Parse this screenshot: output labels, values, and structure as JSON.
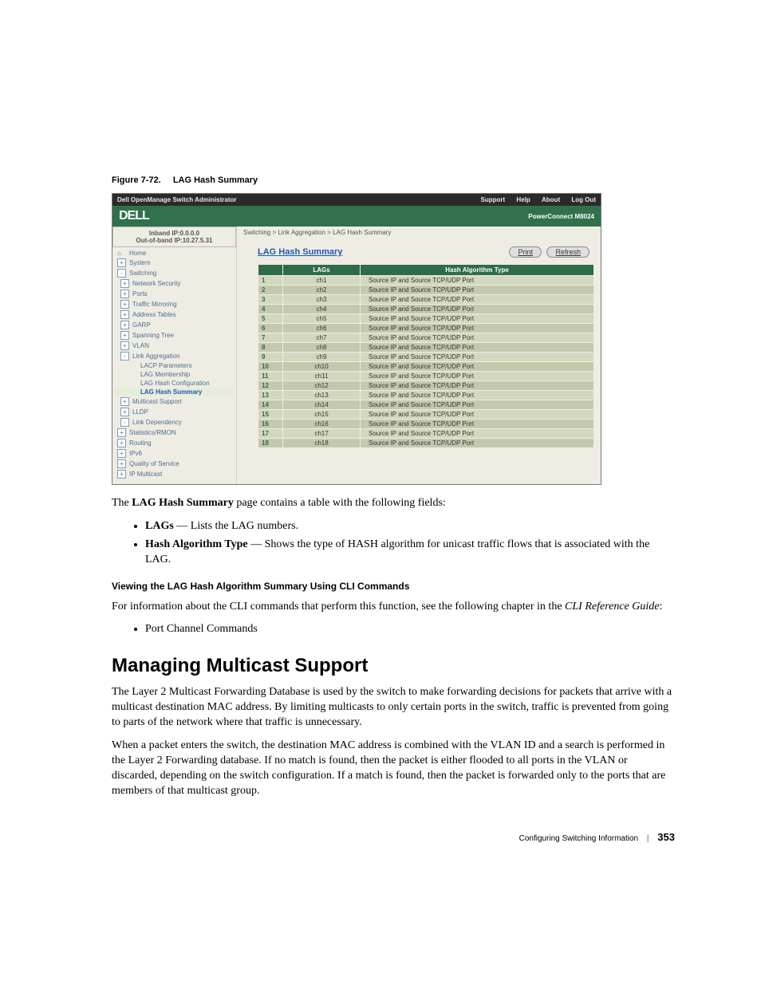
{
  "figure": {
    "num": "Figure 7-72.",
    "title": "LAG Hash Summary"
  },
  "shot": {
    "titlebar": {
      "appname": "Dell OpenManage Switch Administrator",
      "links": {
        "support": "Support",
        "help": "Help",
        "about": "About",
        "logout": "Log Out"
      }
    },
    "brand": {
      "logo": "DELL",
      "model": "PowerConnect M8024"
    },
    "ip": {
      "inband": "Inband IP:0.0.0.0",
      "outband": "Out-of-band IP:10.27.5.31"
    },
    "nav": [
      {
        "lvl": 0,
        "icon": "home",
        "label": "Home"
      },
      {
        "lvl": 0,
        "icon": "+",
        "label": "System"
      },
      {
        "lvl": 0,
        "icon": "-",
        "label": "Switching"
      },
      {
        "lvl": 1,
        "icon": "+",
        "label": "Network Security"
      },
      {
        "lvl": 1,
        "icon": "+",
        "label": "Ports"
      },
      {
        "lvl": 1,
        "icon": "+",
        "label": "Traffic Mirroring"
      },
      {
        "lvl": 1,
        "icon": "+",
        "label": "Address Tables"
      },
      {
        "lvl": 1,
        "icon": "+",
        "label": "GARP"
      },
      {
        "lvl": 1,
        "icon": "+",
        "label": "Spanning Tree"
      },
      {
        "lvl": 1,
        "icon": "+",
        "label": "VLAN"
      },
      {
        "lvl": 1,
        "icon": "-",
        "label": "Link Aggregation"
      },
      {
        "lvl": 2,
        "icon": "",
        "label": "LACP Parameters"
      },
      {
        "lvl": 2,
        "icon": "",
        "label": "LAG Membership"
      },
      {
        "lvl": 2,
        "icon": "",
        "label": "LAG Hash Configuration"
      },
      {
        "lvl": 2,
        "icon": "",
        "label": "LAG Hash Summary",
        "active": true
      },
      {
        "lvl": 1,
        "icon": "+",
        "label": "Multicast Support"
      },
      {
        "lvl": 1,
        "icon": "+",
        "label": "LLDP"
      },
      {
        "lvl": 1,
        "icon": "-",
        "label": "Link Dependency"
      },
      {
        "lvl": 0,
        "icon": "+",
        "label": "Statistics/RMON"
      },
      {
        "lvl": 0,
        "icon": "+",
        "label": "Routing"
      },
      {
        "lvl": 0,
        "icon": "+",
        "label": "IPv6"
      },
      {
        "lvl": 0,
        "icon": "+",
        "label": "Quality of Service"
      },
      {
        "lvl": 0,
        "icon": "+",
        "label": "IP Multicast"
      }
    ],
    "crumb": "Switching > Link Aggregation > LAG Hash Summary",
    "pane": {
      "title": "LAG Hash Summary",
      "print": "Print",
      "refresh": "Refresh",
      "cols": {
        "idx": "",
        "lags": "LAGs",
        "algo": "Hash Algorithm Type"
      },
      "rows": [
        {
          "i": "1",
          "lag": "ch1",
          "algo": "Source IP and Source TCP/UDP Port"
        },
        {
          "i": "2",
          "lag": "ch2",
          "algo": "Source IP and Source TCP/UDP Port"
        },
        {
          "i": "3",
          "lag": "ch3",
          "algo": "Source IP and Source TCP/UDP Port"
        },
        {
          "i": "4",
          "lag": "ch4",
          "algo": "Source IP and Source TCP/UDP Port"
        },
        {
          "i": "5",
          "lag": "ch5",
          "algo": "Source IP and Source TCP/UDP Port"
        },
        {
          "i": "6",
          "lag": "ch6",
          "algo": "Source IP and Source TCP/UDP Port"
        },
        {
          "i": "7",
          "lag": "ch7",
          "algo": "Source IP and Source TCP/UDP Port"
        },
        {
          "i": "8",
          "lag": "ch8",
          "algo": "Source IP and Source TCP/UDP Port"
        },
        {
          "i": "9",
          "lag": "ch9",
          "algo": "Source IP and Source TCP/UDP Port"
        },
        {
          "i": "10",
          "lag": "ch10",
          "algo": "Source IP and Source TCP/UDP Port"
        },
        {
          "i": "11",
          "lag": "ch11",
          "algo": "Source IP and Source TCP/UDP Port"
        },
        {
          "i": "12",
          "lag": "ch12",
          "algo": "Source IP and Source TCP/UDP Port"
        },
        {
          "i": "13",
          "lag": "ch13",
          "algo": "Source IP and Source TCP/UDP Port"
        },
        {
          "i": "14",
          "lag": "ch14",
          "algo": "Source IP and Source TCP/UDP Port"
        },
        {
          "i": "15",
          "lag": "ch15",
          "algo": "Source IP and Source TCP/UDP Port"
        },
        {
          "i": "16",
          "lag": "ch16",
          "algo": "Source IP and Source TCP/UDP Port"
        },
        {
          "i": "17",
          "lag": "ch17",
          "algo": "Source IP and Source TCP/UDP Port"
        },
        {
          "i": "18",
          "lag": "ch18",
          "algo": "Source IP and Source TCP/UDP Port"
        }
      ]
    }
  },
  "body": {
    "p1a": "The ",
    "p1b": "LAG Hash Summary",
    "p1c": " page contains a table with the following fields:",
    "li1a": "LAGs",
    "li1b": " — Lists the LAG numbers.",
    "li2a": "Hash Algorithm Type",
    "li2b": " — Shows the type of HASH algorithm for unicast traffic flows that is associated with the LAG.",
    "sub": "Viewing the LAG Hash Algorithm Summary Using CLI Commands",
    "p2a": "For information about the CLI commands that perform this function, see the following chapter in the ",
    "p2b": "CLI Reference Guide",
    "p2c": ":",
    "li3": "Port Channel Commands",
    "h2": "Managing Multicast Support",
    "p3": "The Layer 2 Multicast Forwarding Database is used by the switch to make forwarding decisions for packets that arrive with a multicast destination MAC address. By limiting multicasts to only certain ports in the switch, traffic is prevented from going to parts of the network where that traffic is unnecessary.",
    "p4": "When a packet enters the switch, the destination MAC address is combined with the VLAN ID and a search is performed in the Layer 2 Forwarding database. If no match is found, then the packet is either flooded to all ports in the VLAN or discarded, depending on the switch configuration. If a match is found, then the packet is forwarded only to the ports that are members of that multicast group."
  },
  "foot": {
    "chapter": "Configuring Switching Information",
    "page": "353"
  }
}
